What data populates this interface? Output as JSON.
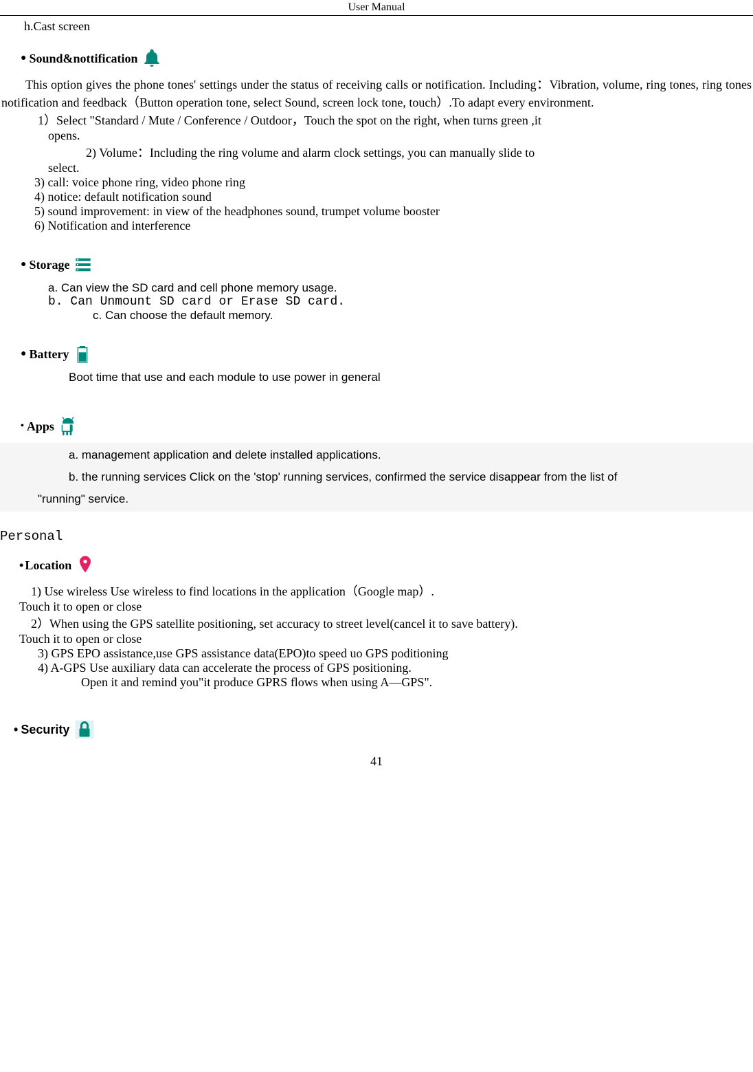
{
  "header": {
    "title": "User    Manual"
  },
  "castScreen": {
    "text": "h.Cast screen"
  },
  "sound": {
    "title": "Sound&nottification",
    "intro": "This option gives the phone tones' settings under the status of receiving calls or notification. Including：Vibration, volume, ring tones, ring tones notification and feedback（Button operation tone, select Sound, screen lock tone, touch）.To adapt every environment.",
    "item1a": "1）Select  \"Standard / Mute / Conference / Outdoor，Touch the spot on the right, when turns green ,it",
    "item1b": "opens.",
    "item2a": "2) Volume：Including the ring volume and alarm clock settings, you can manually slide to",
    "item2b": "select.",
    "item3": "3) call: voice phone ring, video phone ring",
    "item4": "4) notice: default notification sound",
    "item5": "5) sound improvement: in view of the headphones sound, trumpet volume booster",
    "item6": "6) Notification and interference"
  },
  "storage": {
    "title": "Storage",
    "itemA": "a.   Can view the SD card and cell phone memory usage.",
    "itemB": "b. Can Unmount SD card or Erase SD card.",
    "itemC": "c. Can choose the default memory."
  },
  "battery": {
    "title": "Battery",
    "desc": "Boot time that use and each module to use power in general"
  },
  "apps": {
    "title": "Apps",
    "itemA": "a. management application and delete installed applications.",
    "itemB": "b. the running services Click on the 'stop' running services, confirmed the service disappear from the list of",
    "itemB2": "\"running\" service."
  },
  "personal": {
    "heading": "Personal"
  },
  "location": {
    "title": "Location",
    "item1": "1) Use wireless    Use wireless to find locations in the application（Google map）.",
    "touch1": "Touch it to open or close",
    "item2": "2）When using the GPS satellite positioning, set accuracy to street level(cancel it to save battery).",
    "touch2": "Touch it to open or close",
    "item3": "3) GPS EPO assistance,use GPS assistance data(EPO)to speed uo GPS poditioning",
    "item4": "4) A-GPS      Use auxiliary data can accelerate the process of GPS positioning.",
    "item4b": "Open it and remind you\"it produce GPRS flows when using A—GPS\"."
  },
  "security": {
    "title": "Security"
  },
  "pageNumber": "41"
}
